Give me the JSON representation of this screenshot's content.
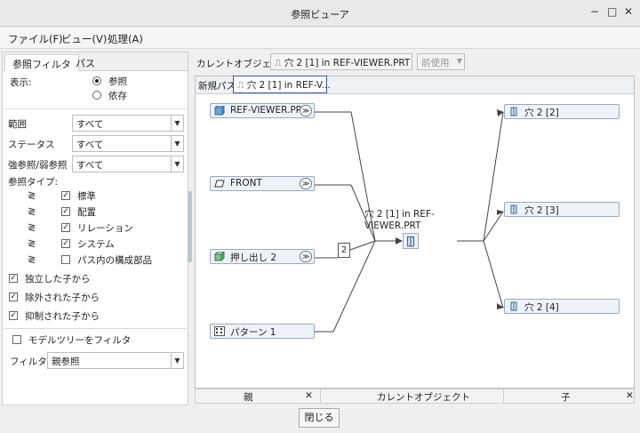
{
  "window": {
    "title": "参照ビューア",
    "minimize": "−",
    "maximize": "□",
    "close": "✕"
  },
  "menu": [
    "ファイル(F)",
    "ビュー(V)",
    "処理(A)"
  ],
  "left": {
    "tabs": [
      "参照フィルタ",
      "パス"
    ],
    "display_label": "表示:",
    "radios": [
      {
        "label": "参照",
        "checked": true
      },
      {
        "label": "依存",
        "checked": false
      }
    ],
    "filters": [
      {
        "label": "範囲",
        "value": "すべて"
      },
      {
        "label": "ステータス",
        "value": "すべて"
      },
      {
        "label": "強参照/弱参照",
        "value": "すべて"
      }
    ],
    "ref_type_label": "参照タイプ:",
    "ref_types": [
      {
        "label": "標準",
        "checked": true
      },
      {
        "label": "配置",
        "checked": true
      },
      {
        "label": "リレーション",
        "checked": true
      },
      {
        "label": "システム",
        "checked": true
      },
      {
        "label": "パス内の構成部品",
        "checked": false
      }
    ],
    "options": [
      {
        "label": "独立した子から",
        "checked": true
      },
      {
        "label": "除外された子から",
        "checked": true
      },
      {
        "label": "抑制された子から",
        "checked": true
      }
    ],
    "model_tree_filter": {
      "label": "モデルツリーをフィルタ",
      "checked": false
    },
    "filter_label": "フィルタ:",
    "filter_value": "親参照"
  },
  "current": {
    "label": "カレントオブジェクト:",
    "value": "穴 2 [1] in REF-VIEWER.PRT",
    "button": "前使用"
  },
  "path": {
    "label": "新規パス:",
    "value": "穴 2 [1] in REF-V..."
  },
  "parents": [
    {
      "label": "REF-VIEWER.PRT",
      "icon": "part-icon"
    },
    {
      "label": "FRONT",
      "icon": "datum-plane-icon"
    },
    {
      "label": "押し出し 2",
      "icon": "extrude-icon"
    },
    {
      "label": "パターン 1",
      "icon": "pattern-icon"
    }
  ],
  "current_node_label": "穴 2 [1] in REF-VIEWER.PRT",
  "junction_count": "2",
  "children": [
    {
      "label": "穴 2 [2]"
    },
    {
      "label": "穴 2 [3]"
    },
    {
      "label": "穴 2 [4]"
    }
  ],
  "bottom": {
    "parent": "親",
    "current": "カレントオブジェクト",
    "child": "子",
    "close_mark": "✕"
  },
  "close_button": "閉じる"
}
